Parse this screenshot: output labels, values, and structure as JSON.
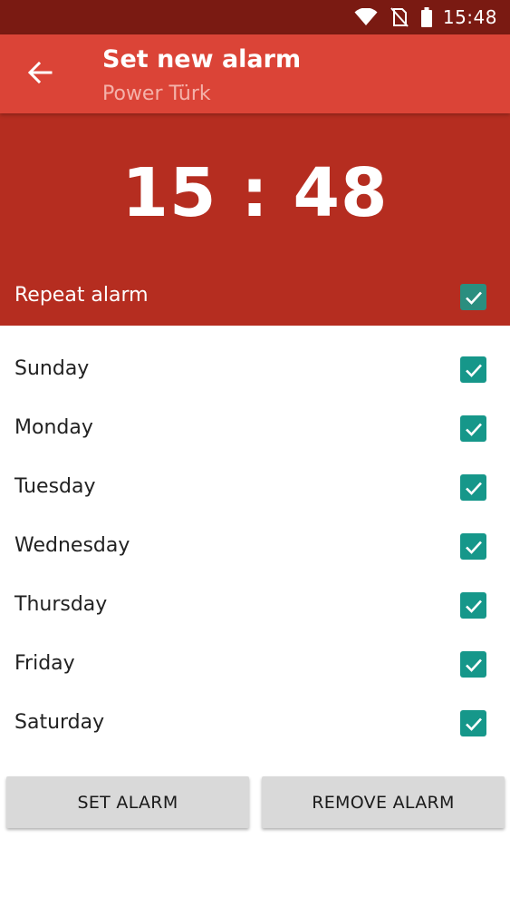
{
  "status_bar": {
    "time": "15:48",
    "icons": [
      "wifi-icon",
      "no-sim-icon",
      "battery-icon"
    ]
  },
  "toolbar": {
    "title": "Set new alarm",
    "subtitle": "Power Türk",
    "back_icon": "arrow-left-icon"
  },
  "clock": {
    "time": "15 : 48"
  },
  "repeat": {
    "label": "Repeat alarm",
    "checked": true
  },
  "days": [
    {
      "label": "Sunday",
      "checked": true
    },
    {
      "label": "Monday",
      "checked": true
    },
    {
      "label": "Tuesday",
      "checked": true
    },
    {
      "label": "Wednesday",
      "checked": true
    },
    {
      "label": "Thursday",
      "checked": true
    },
    {
      "label": "Friday",
      "checked": true
    },
    {
      "label": "Saturday",
      "checked": true
    }
  ],
  "buttons": {
    "set_alarm": "SET ALARM",
    "remove_alarm": "REMOVE ALARM"
  },
  "colors": {
    "status_bar": "#7a1a12",
    "toolbar": "#db4437",
    "clock_panel": "#b52d20",
    "checkbox": "#16978a",
    "button": "#d9d9d9"
  }
}
